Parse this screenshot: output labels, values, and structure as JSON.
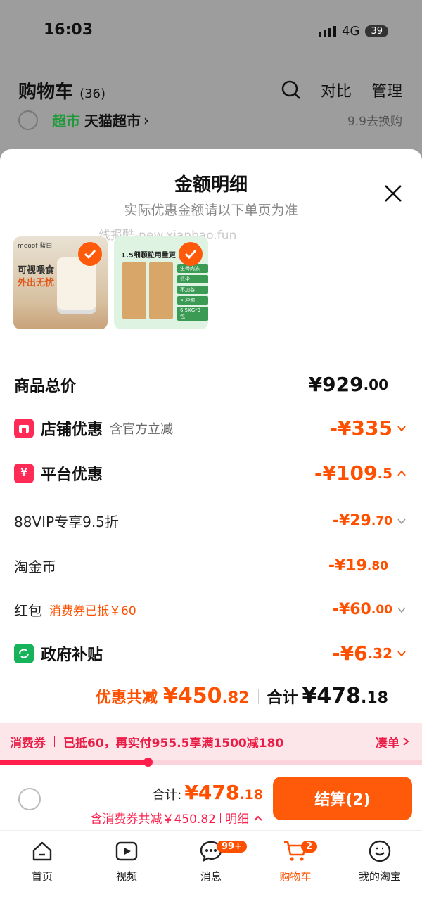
{
  "status_bar": {
    "time": "16:03",
    "network": "4G",
    "battery": "39"
  },
  "background": {
    "title": "购物车",
    "count": "(36)",
    "compare_label": "对比",
    "manage_label": "管理",
    "store_tag": "超市",
    "store_name": "天猫超市",
    "store_right": "9.9去换购"
  },
  "sheet": {
    "title": "金额明细",
    "subtitle": "实际优惠金额请以下单页为准",
    "watermark": "线报酷-new.xianbao.fun"
  },
  "products": [
    {
      "brand": "meoof 蓝白",
      "headline_1": "可视喂食",
      "headline_2": "外出无忧",
      "selected": true
    },
    {
      "headline": "1.5细颗粒用量更",
      "chips": [
        "生骨肉冻",
        "低尘",
        "不加谷",
        "可冲泡",
        "6.5KG*3包"
      ],
      "selected": true
    }
  ],
  "rows": {
    "total": {
      "label": "商品总价",
      "yen": "¥",
      "int": "929",
      "dec": ".00"
    },
    "store_discount": {
      "label": "店铺优惠",
      "note": "含官方立减",
      "int": "-¥335",
      "dec": ""
    },
    "platform_discount": {
      "label": "平台优惠",
      "int": "-¥109",
      "dec": ".5"
    },
    "vip": {
      "label": "88VIP专享9.5折",
      "int": "-¥29",
      "dec": ".70"
    },
    "coins": {
      "label": "淘金币",
      "int": "-¥19",
      "dec": ".80"
    },
    "redpacket": {
      "label": "红包",
      "note": "消费券已抵￥60",
      "int": "-¥60",
      "dec": ".00"
    },
    "subsidy": {
      "label": "政府补贴",
      "int": "-¥6",
      "dec": ".32"
    }
  },
  "summary": {
    "discount_label": "优惠共减",
    "discount_int": "¥450",
    "discount_dec": ".82",
    "total_label": "合计",
    "total_int": "¥478",
    "total_dec": ".18"
  },
  "coupon_bar": {
    "label": "消费券",
    "message": "已抵60，再实付955.5享满1500减180",
    "action": "凑单",
    "progress": 0.35
  },
  "checkout": {
    "total_label": "合计:",
    "total_int": "¥478",
    "total_dec": ".18",
    "note": "含消费券共减￥450.82",
    "detail": "明细",
    "pay_label": "结算(2)"
  },
  "tabs": [
    {
      "label": "首页",
      "icon": "home-icon"
    },
    {
      "label": "视频",
      "icon": "video-icon"
    },
    {
      "label": "消息",
      "icon": "message-icon",
      "badge": "99+"
    },
    {
      "label": "购物车",
      "icon": "cart-icon",
      "badge": "2",
      "active": true
    },
    {
      "label": "我的淘宝",
      "icon": "profile-icon"
    }
  ],
  "colors": {
    "accent": "#ff5000",
    "coupon": "#ea1d46",
    "subsidy_green": "#16b35a"
  }
}
